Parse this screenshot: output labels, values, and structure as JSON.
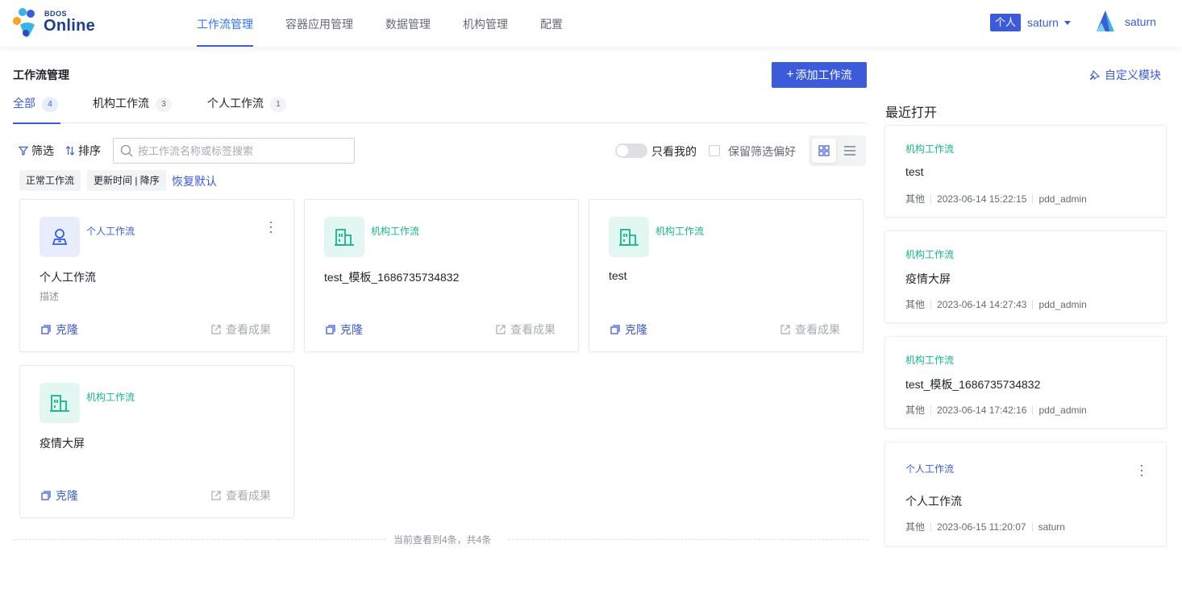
{
  "brand": {
    "small": "BDOS",
    "big": "Online"
  },
  "nav": {
    "tabs": [
      "工作流管理",
      "容器应用管理",
      "数据管理",
      "机构管理",
      "配置"
    ],
    "active_index": 0
  },
  "tenant": {
    "badge": "个人",
    "name": "saturn"
  },
  "user": {
    "name": "saturn"
  },
  "page": {
    "title": "工作流管理",
    "add_button": "添加工作流",
    "tabs": [
      {
        "label": "全部",
        "count": "4"
      },
      {
        "label": "机构工作流",
        "count": "3"
      },
      {
        "label": "个人工作流",
        "count": "1"
      }
    ]
  },
  "toolbar": {
    "filter": "筛选",
    "sort": "排序",
    "search_placeholder": "按工作流名称或标签搜索",
    "only_mine": "只看我的",
    "keep_filter": "保留筛选偏好"
  },
  "filters": {
    "chips": [
      "正常工作流",
      "更新时间 | 降序"
    ],
    "reset": "恢复默认"
  },
  "cards": [
    {
      "type": "个人工作流",
      "kind": "personal",
      "name": "个人工作流",
      "desc": "描述",
      "clone": "克隆",
      "result": "查看成果"
    },
    {
      "type": "机构工作流",
      "kind": "org",
      "name": "test_模板_1686735734832",
      "desc": "",
      "clone": "克隆",
      "result": "查看成果"
    },
    {
      "type": "机构工作流",
      "kind": "org",
      "name": "test",
      "desc": "",
      "clone": "克隆",
      "result": "查看成果"
    },
    {
      "type": "机构工作流",
      "kind": "org",
      "name": "疫情大屏",
      "desc": "",
      "clone": "克隆",
      "result": "查看成果"
    }
  ],
  "footer": "当前查看到4条，共4条",
  "sidebar": {
    "custom_module": "自定义模块",
    "recent_title": "最近打开",
    "recent": [
      {
        "type": "机构工作流",
        "kind": "org",
        "name": "test",
        "category": "其他",
        "time": "2023-06-14 15:22:15",
        "owner": "pdd_admin"
      },
      {
        "type": "机构工作流",
        "kind": "org",
        "name": "疫情大屏",
        "category": "其他",
        "time": "2023-06-14 14:27:43",
        "owner": "pdd_admin"
      },
      {
        "type": "机构工作流",
        "kind": "org",
        "name": "test_模板_1686735734832",
        "category": "其他",
        "time": "2023-06-14 17:42:16",
        "owner": "pdd_admin"
      },
      {
        "type": "个人工作流",
        "kind": "personal",
        "name": "个人工作流",
        "category": "其他",
        "time": "2023-06-15 11:20:07",
        "owner": "saturn"
      }
    ]
  },
  "colors": {
    "primary": "#3b5bdb",
    "org": "#14b68a",
    "personal": "#3b5bdb"
  }
}
